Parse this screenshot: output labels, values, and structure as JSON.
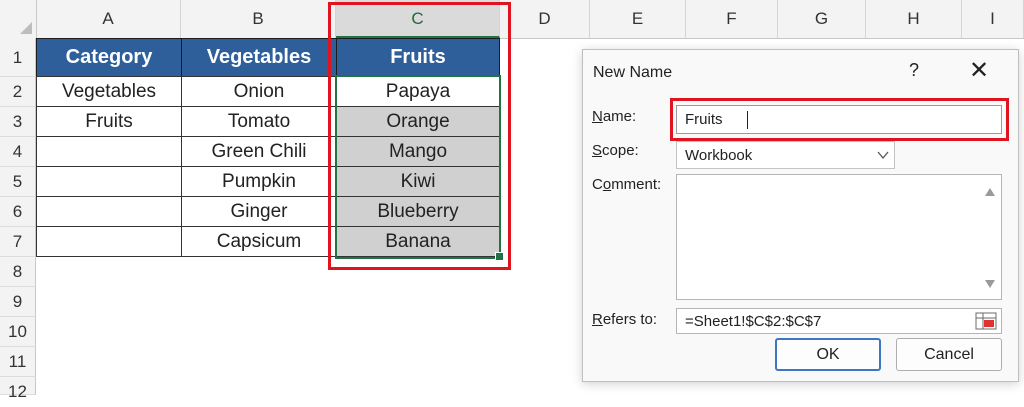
{
  "columns": [
    "A",
    "B",
    "C",
    "D",
    "E",
    "F",
    "G",
    "H",
    "I"
  ],
  "rows": [
    "1",
    "2",
    "3",
    "4",
    "5",
    "6",
    "7",
    "8",
    "9",
    "10",
    "11",
    "12"
  ],
  "table": {
    "headers": [
      "Category",
      "Vegetables",
      "Fruits"
    ],
    "category": [
      "Vegetables",
      "Fruits",
      "",
      "",
      "",
      ""
    ],
    "vegetables": [
      "Onion",
      "Tomato",
      "Green Chili",
      "Pumpkin",
      "Ginger",
      "Capsicum"
    ],
    "fruits": [
      "Papaya",
      "Orange",
      "Mango",
      "Kiwi",
      "Blueberry",
      "Banana"
    ]
  },
  "dialog": {
    "title": "New Name",
    "help": "?",
    "close": "✕",
    "name_label_u": "N",
    "name_label_rest": "ame:",
    "name_value": "Fruits",
    "scope_label_u": "S",
    "scope_label_rest": "cope:",
    "scope_value": "Workbook",
    "comment_label_pre": "C",
    "comment_label_u": "o",
    "comment_label_rest": "mment:",
    "comment_value": "",
    "refers_label_u": "R",
    "refers_label_rest": "efers to:",
    "refers_value": "=Sheet1!$C$2:$C$7",
    "ok_label": "OK",
    "cancel_label": "Cancel"
  },
  "colors": {
    "header_fill": "#2f5f9a",
    "selection_green": "#217346",
    "highlight_red": "#e0141e"
  }
}
